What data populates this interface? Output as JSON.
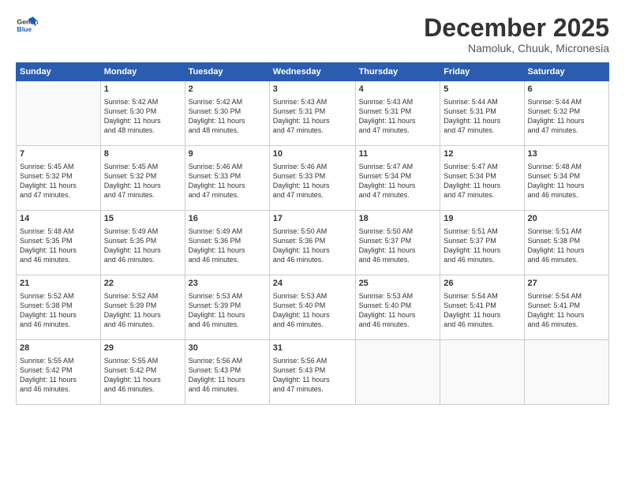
{
  "header": {
    "logo_line1": "General",
    "logo_line2": "Blue",
    "month": "December 2025",
    "location": "Namoluk, Chuuk, Micronesia"
  },
  "days_of_week": [
    "Sunday",
    "Monday",
    "Tuesday",
    "Wednesday",
    "Thursday",
    "Friday",
    "Saturday"
  ],
  "weeks": [
    [
      {
        "day": "",
        "detail": ""
      },
      {
        "day": "1",
        "detail": "Sunrise: 5:42 AM\nSunset: 5:30 PM\nDaylight: 11 hours\nand 48 minutes."
      },
      {
        "day": "2",
        "detail": "Sunrise: 5:42 AM\nSunset: 5:30 PM\nDaylight: 11 hours\nand 48 minutes."
      },
      {
        "day": "3",
        "detail": "Sunrise: 5:43 AM\nSunset: 5:31 PM\nDaylight: 11 hours\nand 47 minutes."
      },
      {
        "day": "4",
        "detail": "Sunrise: 5:43 AM\nSunset: 5:31 PM\nDaylight: 11 hours\nand 47 minutes."
      },
      {
        "day": "5",
        "detail": "Sunrise: 5:44 AM\nSunset: 5:31 PM\nDaylight: 11 hours\nand 47 minutes."
      },
      {
        "day": "6",
        "detail": "Sunrise: 5:44 AM\nSunset: 5:32 PM\nDaylight: 11 hours\nand 47 minutes."
      }
    ],
    [
      {
        "day": "7",
        "detail": "Sunrise: 5:45 AM\nSunset: 5:32 PM\nDaylight: 11 hours\nand 47 minutes."
      },
      {
        "day": "8",
        "detail": "Sunrise: 5:45 AM\nSunset: 5:32 PM\nDaylight: 11 hours\nand 47 minutes."
      },
      {
        "day": "9",
        "detail": "Sunrise: 5:46 AM\nSunset: 5:33 PM\nDaylight: 11 hours\nand 47 minutes."
      },
      {
        "day": "10",
        "detail": "Sunrise: 5:46 AM\nSunset: 5:33 PM\nDaylight: 11 hours\nand 47 minutes."
      },
      {
        "day": "11",
        "detail": "Sunrise: 5:47 AM\nSunset: 5:34 PM\nDaylight: 11 hours\nand 47 minutes."
      },
      {
        "day": "12",
        "detail": "Sunrise: 5:47 AM\nSunset: 5:34 PM\nDaylight: 11 hours\nand 47 minutes."
      },
      {
        "day": "13",
        "detail": "Sunrise: 5:48 AM\nSunset: 5:34 PM\nDaylight: 11 hours\nand 46 minutes."
      }
    ],
    [
      {
        "day": "14",
        "detail": "Sunrise: 5:48 AM\nSunset: 5:35 PM\nDaylight: 11 hours\nand 46 minutes."
      },
      {
        "day": "15",
        "detail": "Sunrise: 5:49 AM\nSunset: 5:35 PM\nDaylight: 11 hours\nand 46 minutes."
      },
      {
        "day": "16",
        "detail": "Sunrise: 5:49 AM\nSunset: 5:36 PM\nDaylight: 11 hours\nand 46 minutes."
      },
      {
        "day": "17",
        "detail": "Sunrise: 5:50 AM\nSunset: 5:36 PM\nDaylight: 11 hours\nand 46 minutes."
      },
      {
        "day": "18",
        "detail": "Sunrise: 5:50 AM\nSunset: 5:37 PM\nDaylight: 11 hours\nand 46 minutes."
      },
      {
        "day": "19",
        "detail": "Sunrise: 5:51 AM\nSunset: 5:37 PM\nDaylight: 11 hours\nand 46 minutes."
      },
      {
        "day": "20",
        "detail": "Sunrise: 5:51 AM\nSunset: 5:38 PM\nDaylight: 11 hours\nand 46 minutes."
      }
    ],
    [
      {
        "day": "21",
        "detail": "Sunrise: 5:52 AM\nSunset: 5:38 PM\nDaylight: 11 hours\nand 46 minutes."
      },
      {
        "day": "22",
        "detail": "Sunrise: 5:52 AM\nSunset: 5:39 PM\nDaylight: 11 hours\nand 46 minutes."
      },
      {
        "day": "23",
        "detail": "Sunrise: 5:53 AM\nSunset: 5:39 PM\nDaylight: 11 hours\nand 46 minutes."
      },
      {
        "day": "24",
        "detail": "Sunrise: 5:53 AM\nSunset: 5:40 PM\nDaylight: 11 hours\nand 46 minutes."
      },
      {
        "day": "25",
        "detail": "Sunrise: 5:53 AM\nSunset: 5:40 PM\nDaylight: 11 hours\nand 46 minutes."
      },
      {
        "day": "26",
        "detail": "Sunrise: 5:54 AM\nSunset: 5:41 PM\nDaylight: 11 hours\nand 46 minutes."
      },
      {
        "day": "27",
        "detail": "Sunrise: 5:54 AM\nSunset: 5:41 PM\nDaylight: 11 hours\nand 46 minutes."
      }
    ],
    [
      {
        "day": "28",
        "detail": "Sunrise: 5:55 AM\nSunset: 5:42 PM\nDaylight: 11 hours\nand 46 minutes."
      },
      {
        "day": "29",
        "detail": "Sunrise: 5:55 AM\nSunset: 5:42 PM\nDaylight: 11 hours\nand 46 minutes."
      },
      {
        "day": "30",
        "detail": "Sunrise: 5:56 AM\nSunset: 5:43 PM\nDaylight: 11 hours\nand 46 minutes."
      },
      {
        "day": "31",
        "detail": "Sunrise: 5:56 AM\nSunset: 5:43 PM\nDaylight: 11 hours\nand 47 minutes."
      },
      {
        "day": "",
        "detail": ""
      },
      {
        "day": "",
        "detail": ""
      },
      {
        "day": "",
        "detail": ""
      }
    ]
  ]
}
